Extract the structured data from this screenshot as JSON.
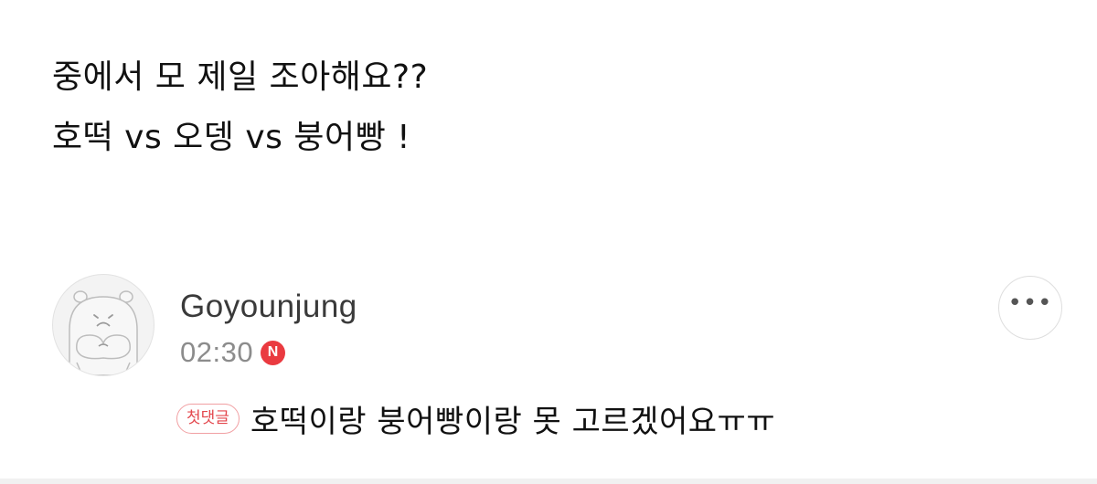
{
  "post": {
    "lines": [
      "중에서 모 제일 조아해요??",
      "호떡 vs 오뎅 vs 붕어빵 !"
    ]
  },
  "comment": {
    "author": "Goyounjung",
    "time": "02:30",
    "new_badge": "N",
    "first_comment_badge": "첫댓글",
    "text": "호떡이랑 붕어빵이랑 못 고르겠어요ㅠㅠ",
    "more_icon": "more-horizontal-icon",
    "more_label": "•••",
    "avatar_icon": "hamster-avatar-icon"
  },
  "colors": {
    "accent_red": "#ea3a40",
    "badge_border": "#f1a0a3",
    "muted_text": "#8c8c8c"
  }
}
